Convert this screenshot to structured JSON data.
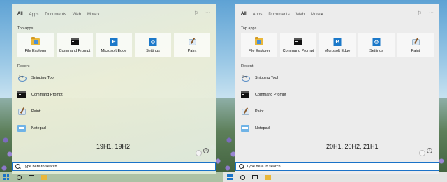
{
  "tabs": [
    {
      "label": "All"
    },
    {
      "label": "Apps"
    },
    {
      "label": "Documents"
    },
    {
      "label": "Web"
    },
    {
      "label": "More",
      "caret": "▾"
    }
  ],
  "toolbar_icons": {
    "feedback": "feedback-icon",
    "more": "···"
  },
  "top_apps_label": "Top apps",
  "top_apps": [
    {
      "label": "File Explorer",
      "icon": "file-explorer-icon"
    },
    {
      "label": "Command Prompt",
      "icon": "command-prompt-icon"
    },
    {
      "label": "Microsoft Edge",
      "icon": "edge-icon"
    },
    {
      "label": "Settings",
      "icon": "settings-gear-icon"
    },
    {
      "label": "Paint",
      "icon": "paint-icon"
    }
  ],
  "recent_label": "Recent",
  "recent": [
    {
      "label": "Snipping Tool",
      "icon": "snipping-tool-icon"
    },
    {
      "label": "Command Prompt",
      "icon": "command-prompt-icon"
    },
    {
      "label": "Paint",
      "icon": "paint-icon"
    },
    {
      "label": "Notepad",
      "icon": "notepad-icon"
    }
  ],
  "versions": {
    "left": "19H1, 19H2",
    "right": "20H1, 20H2, 21H1"
  },
  "info_glyph": "i",
  "search": {
    "placeholder": "Type here to search"
  },
  "colors": {
    "accent": "#1a73c8",
    "left_panel": "#e6ecdc",
    "right_panel": "#ececec"
  }
}
